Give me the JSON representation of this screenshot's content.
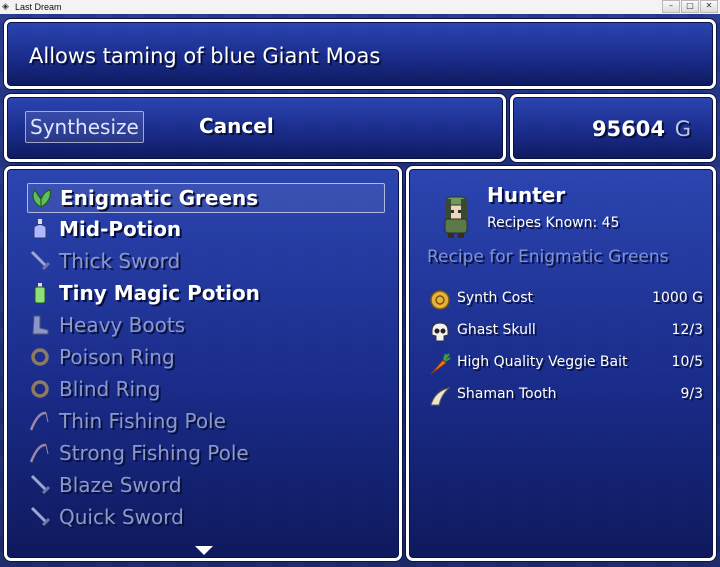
{
  "window": {
    "title": "Last Dream"
  },
  "description": "Allows taming of blue Giant Moas",
  "commands": {
    "synthesize": "Synthesize",
    "cancel": "Cancel"
  },
  "gold": {
    "amount": "95604",
    "unit": "G"
  },
  "items": [
    {
      "label": "Enigmatic Greens",
      "icon": "greens-icon",
      "enabled": true,
      "selected": true
    },
    {
      "label": "Mid-Potion",
      "icon": "potion-icon",
      "enabled": true
    },
    {
      "label": "Thick Sword",
      "icon": "sword-icon",
      "enabled": false
    },
    {
      "label": "Tiny Magic Potion",
      "icon": "magic-potion-icon",
      "enabled": true
    },
    {
      "label": "Heavy Boots",
      "icon": "boots-icon",
      "enabled": false
    },
    {
      "label": "Poison Ring",
      "icon": "ring-icon",
      "enabled": false
    },
    {
      "label": "Blind Ring",
      "icon": "ring-icon",
      "enabled": false
    },
    {
      "label": "Thin Fishing Pole",
      "icon": "fishing-pole-icon",
      "enabled": false
    },
    {
      "label": "Strong Fishing Pole",
      "icon": "fishing-pole-icon",
      "enabled": false
    },
    {
      "label": "Blaze Sword",
      "icon": "sword-icon",
      "enabled": false
    },
    {
      "label": "Quick Sword",
      "icon": "sword-icon",
      "enabled": false
    }
  ],
  "character": {
    "name": "Hunter",
    "recipes_known": "Recipes Known: 45"
  },
  "recipe": {
    "title": "Recipe for Enigmatic Greens",
    "rows": [
      {
        "name": "Synth Cost",
        "value": "1000 G",
        "icon": "coin-icon"
      },
      {
        "name": "Ghast Skull",
        "value": "12/3",
        "icon": "skull-icon"
      },
      {
        "name": "High Quality Veggie Bait",
        "value": "10/5",
        "icon": "carrot-icon"
      },
      {
        "name": "Shaman Tooth",
        "value": "9/3",
        "icon": "horn-icon"
      }
    ]
  },
  "colors": {
    "window_top": "#2c46b4",
    "window_bottom": "#0e185c",
    "disabled_text": "#8c98c8",
    "recipe_title": "#7f91d9"
  }
}
